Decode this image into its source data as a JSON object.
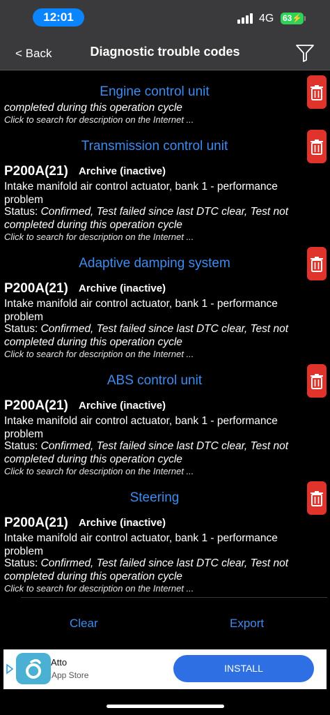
{
  "status_bar": {
    "time": "12:01",
    "network": "4G",
    "battery": "63"
  },
  "nav": {
    "back_label": "< Back",
    "title": "Diagnostic trouble codes"
  },
  "partial_entry": {
    "status_tail": "completed during this operation cycle",
    "hint": "Click to search for description on the Internet ..."
  },
  "sections": [
    {
      "unit": "Engine control unit"
    },
    {
      "unit": "Transmission control unit",
      "code": "P200A(21)",
      "archive": "Archive (inactive)",
      "desc": "Intake manifold air control actuator, bank 1 - performance problem",
      "status_label": "Status: ",
      "status_value": "Confirmed, Test failed since last DTC clear, Test not completed during this operation cycle",
      "hint": "Click to search for description on the Internet ..."
    },
    {
      "unit": "Adaptive damping system",
      "code": "P200A(21)",
      "archive": "Archive (inactive)",
      "desc": "Intake manifold air control actuator, bank 1 - performance problem",
      "status_label": "Status: ",
      "status_value": "Confirmed, Test failed since last DTC clear, Test not completed during this operation cycle",
      "hint": "Click to search for description on the Internet ..."
    },
    {
      "unit": "ABS control unit",
      "code": "P200A(21)",
      "archive": "Archive (inactive)",
      "desc": "Intake manifold air control actuator, bank 1 - performance problem",
      "status_label": "Status: ",
      "status_value": "Confirmed, Test failed since last DTC clear, Test not completed during this operation cycle",
      "hint": "Click to search for description on the Internet ..."
    },
    {
      "unit": "Steering",
      "code": "P200A(21)",
      "archive": "Archive (inactive)",
      "desc": "Intake manifold air control actuator, bank 1 - performance problem",
      "status_label": "Status: ",
      "status_value": "Confirmed, Test failed since last DTC clear, Test not completed during this operation cycle",
      "hint": "Click to search for description on the Internet ..."
    }
  ],
  "actions": {
    "clear": "Clear",
    "export": "Export"
  },
  "ad": {
    "app_name": "Atto",
    "store": "App Store",
    "install": "INSTALL"
  },
  "colors": {
    "accent": "#3d8cf0",
    "delete": "#e0332b",
    "battery": "#30d158"
  }
}
